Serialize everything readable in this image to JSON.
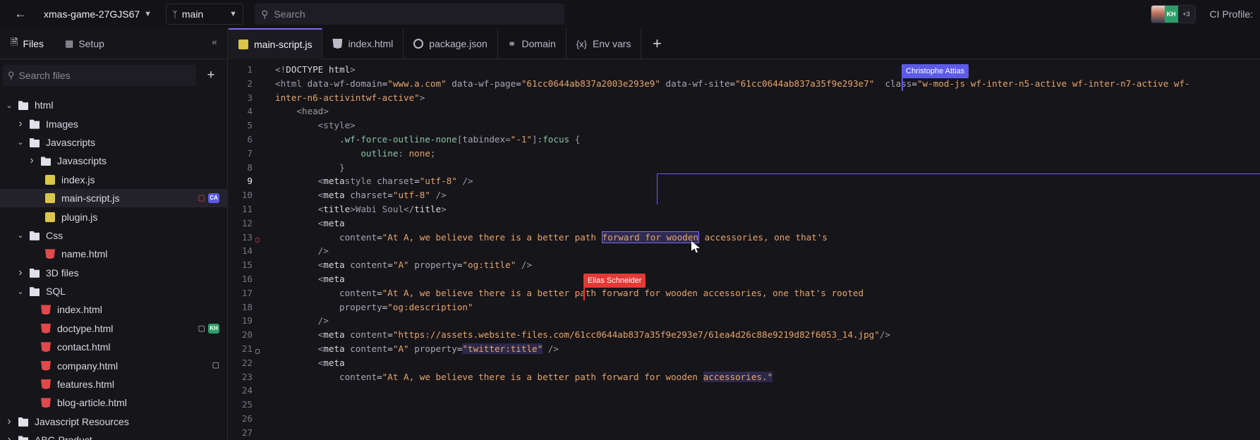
{
  "header": {
    "project": "xmas-game-27GJS67",
    "branch": "main",
    "search_placeholder": "Search",
    "collaborators_more": "+3",
    "collaborator_initials": "KH",
    "right_label": "CI Profile:"
  },
  "sidebar": {
    "tabs": [
      "Files",
      "Setup"
    ],
    "search_placeholder": "Search files",
    "tree": [
      {
        "label": "html",
        "type": "folder",
        "level": 0,
        "expanded": true
      },
      {
        "label": "Images",
        "type": "folder",
        "level": 1,
        "expanded": false
      },
      {
        "label": "Javascripts",
        "type": "folder",
        "level": 1,
        "expanded": true
      },
      {
        "label": "Javascripts",
        "type": "folder",
        "level": 2,
        "expanded": false
      },
      {
        "label": "index.js",
        "type": "js",
        "level": 2
      },
      {
        "label": "main-script.js",
        "type": "js",
        "level": 2,
        "selected": true,
        "comment": true,
        "avatar": "CA"
      },
      {
        "label": "plugin.js",
        "type": "js",
        "level": 2
      },
      {
        "label": "Css",
        "type": "folder",
        "level": 1,
        "expanded": true
      },
      {
        "label": "name.html",
        "type": "html",
        "level": 2
      },
      {
        "label": "3D files",
        "type": "folder",
        "level": 1,
        "expanded": false
      },
      {
        "label": "SQL",
        "type": "folder",
        "level": 1,
        "expanded": true
      },
      {
        "label": "index.html",
        "type": "html",
        "level": 1
      },
      {
        "label": "doctype.html",
        "type": "html",
        "level": 1,
        "comment": true,
        "avatar": "KH"
      },
      {
        "label": "contact.html",
        "type": "html",
        "level": 1
      },
      {
        "label": "company.html",
        "type": "html",
        "level": 1,
        "comment": true
      },
      {
        "label": "features.html",
        "type": "html",
        "level": 1
      },
      {
        "label": "blog-article.html",
        "type": "html",
        "level": 1
      },
      {
        "label": "Javascript Resources",
        "type": "folder",
        "level": 0,
        "expanded": false
      },
      {
        "label": "ABC-Product",
        "type": "folder",
        "level": 0,
        "expanded": false
      }
    ]
  },
  "editor_tabs": [
    {
      "label": "main-script.js",
      "icon": "js",
      "active": true
    },
    {
      "label": "index.html",
      "icon": "html"
    },
    {
      "label": "package.json",
      "icon": "json"
    },
    {
      "label": "Domain",
      "icon": "link"
    },
    {
      "label": "Env vars",
      "icon": "brace"
    }
  ],
  "editor": {
    "current_line": 9,
    "lines": [
      {
        "n": 1,
        "tokens": [
          [
            "t",
            "<!"
          ],
          [
            "w",
            "DOCTYPE html"
          ],
          [
            "t",
            ">"
          ]
        ]
      },
      {
        "n": 2,
        "tokens": [
          [
            "t",
            "<html "
          ],
          [
            "a",
            "data-wf-domain"
          ],
          [
            "w",
            "="
          ],
          [
            "s",
            "\"www.a.com\""
          ],
          [
            "a",
            " data-wf-page"
          ],
          [
            "w",
            "="
          ],
          [
            "s",
            "\"61cc0644ab837a2003e293e9\""
          ],
          [
            "a",
            " data-wf-site"
          ],
          [
            "w",
            "="
          ],
          [
            "s",
            "\"61cc0644ab837a35f9e293e7\""
          ],
          [
            "a",
            "  class"
          ],
          [
            "w",
            "="
          ],
          [
            "s",
            "\"w-mod-js wf-inter-n5-active wf-inter-n7-active wf-"
          ]
        ]
      },
      {
        "n": 3,
        "tokens": [
          [
            "s",
            "inter-n6-activintwf-active\""
          ],
          [
            "t",
            ">"
          ]
        ]
      },
      {
        "n": 4,
        "tokens": [
          [
            "w",
            "    "
          ],
          [
            "t",
            "<head>"
          ]
        ]
      },
      {
        "n": 5,
        "tokens": [
          [
            "w",
            "        "
          ],
          [
            "t",
            "<style>"
          ]
        ]
      },
      {
        "n": 6,
        "tokens": [
          [
            "w",
            "            "
          ],
          [
            "c",
            ".wf-force-outline-none"
          ],
          [
            "t",
            "["
          ],
          [
            "a",
            "tabindex"
          ],
          [
            "t",
            "="
          ],
          [
            "s",
            "\"-1\""
          ],
          [
            "t",
            "]"
          ],
          [
            "c",
            ":focus "
          ],
          [
            "t",
            "{"
          ]
        ]
      },
      {
        "n": 7,
        "tokens": [
          [
            "w",
            "                "
          ],
          [
            "c",
            "outline"
          ],
          [
            "t",
            ": "
          ],
          [
            "s",
            "none"
          ],
          [
            "t",
            ";"
          ]
        ]
      },
      {
        "n": 8,
        "tokens": [
          [
            "w",
            "            "
          ],
          [
            "t",
            "}"
          ]
        ]
      },
      {
        "n": 9,
        "tokens": [
          [
            "w",
            "        "
          ],
          [
            "t",
            "<"
          ],
          [
            "w",
            "meta"
          ],
          [
            "t",
            "style "
          ],
          [
            "a",
            "charset"
          ],
          [
            "w",
            "="
          ],
          [
            "s",
            "\"utf-8\""
          ],
          [
            "t",
            " />"
          ]
        ]
      },
      {
        "n": 10,
        "tokens": [
          [
            "w",
            "        "
          ],
          [
            "t",
            "<"
          ],
          [
            "w",
            "meta "
          ],
          [
            "a",
            "charset"
          ],
          [
            "w",
            "="
          ],
          [
            "s",
            "\"utf-8\""
          ],
          [
            "t",
            " />"
          ]
        ]
      },
      {
        "n": 11,
        "tokens": [
          [
            "w",
            "        "
          ],
          [
            "t",
            "<"
          ],
          [
            "w",
            "title"
          ],
          [
            "t",
            ">Wabi Soul</"
          ],
          [
            "w",
            "title"
          ],
          [
            "t",
            ">"
          ]
        ]
      },
      {
        "n": 12,
        "tokens": [
          [
            "w",
            "        "
          ],
          [
            "t",
            "<"
          ],
          [
            "w",
            "meta"
          ]
        ]
      },
      {
        "n": 13,
        "tokens": [
          [
            "w",
            "            "
          ],
          [
            "a",
            "content"
          ],
          [
            "w",
            "="
          ],
          [
            "s",
            "\"At A, we believe there is a better path "
          ],
          [
            "sel",
            "forward for wooden"
          ],
          [
            "s",
            " accessories, one that's"
          ]
        ],
        "gutter": "red"
      },
      {
        "n": 14,
        "tokens": [
          [
            "w",
            "        "
          ],
          [
            "t",
            "/>"
          ]
        ]
      },
      {
        "n": 15,
        "tokens": [
          [
            "w",
            "        "
          ],
          [
            "t",
            "<"
          ],
          [
            "w",
            "meta "
          ],
          [
            "a",
            "content"
          ],
          [
            "w",
            "="
          ],
          [
            "s",
            "\"A\""
          ],
          [
            "a",
            " property"
          ],
          [
            "w",
            "="
          ],
          [
            "s",
            "\"og:title\""
          ],
          [
            "t",
            " />"
          ]
        ]
      },
      {
        "n": 16,
        "tokens": [
          [
            "w",
            "        "
          ],
          [
            "t",
            "<"
          ],
          [
            "w",
            "meta"
          ]
        ]
      },
      {
        "n": 17,
        "tokens": [
          [
            "w",
            "            "
          ],
          [
            "a",
            "content"
          ],
          [
            "w",
            "="
          ],
          [
            "s",
            "\"At A, we believe there is a better path forward for wooden accessories, one that's rooted"
          ]
        ]
      },
      {
        "n": 18,
        "tokens": [
          [
            "w",
            "            "
          ],
          [
            "a",
            "property"
          ],
          [
            "w",
            "="
          ],
          [
            "s",
            "\"og:description\""
          ]
        ]
      },
      {
        "n": 19,
        "tokens": [
          [
            "w",
            "        "
          ],
          [
            "t",
            "/>"
          ]
        ]
      },
      {
        "n": 20,
        "tokens": [
          [
            "w",
            "        "
          ],
          [
            "t",
            "<"
          ],
          [
            "w",
            "meta "
          ],
          [
            "a",
            "content"
          ],
          [
            "w",
            "="
          ],
          [
            "s",
            "\"https://assets.website-files.com/61cc0644ab837a35f9e293e7/61ea4d26c88e9219d82f6053_14.jpg\""
          ],
          [
            "t",
            "/>"
          ]
        ]
      },
      {
        "n": 21,
        "tokens": [
          [
            "w",
            "        "
          ],
          [
            "t",
            "<"
          ],
          [
            "w",
            "meta "
          ],
          [
            "a",
            "content"
          ],
          [
            "w",
            "="
          ],
          [
            "s",
            "\"A\""
          ],
          [
            "a",
            " property"
          ],
          [
            "w",
            "="
          ],
          [
            "soft",
            "\"twitter:title\""
          ],
          [
            "t",
            " />"
          ]
        ],
        "gutter": "normal"
      },
      {
        "n": 22,
        "tokens": [
          [
            "w",
            "        "
          ],
          [
            "t",
            "<"
          ],
          [
            "w",
            "meta"
          ]
        ]
      },
      {
        "n": 23,
        "tokens": [
          [
            "w",
            "            "
          ],
          [
            "a",
            "content"
          ],
          [
            "w",
            "="
          ],
          [
            "s",
            "\"At A, we believe there is a better path forward for wooden "
          ],
          [
            "soft",
            "accessories.\""
          ]
        ]
      },
      {
        "n": 24,
        "tokens": []
      },
      {
        "n": 25,
        "tokens": []
      },
      {
        "n": 26,
        "tokens": []
      },
      {
        "n": 27,
        "tokens": []
      }
    ]
  },
  "collaborator_cursors": [
    {
      "name": "Christophe Attias",
      "color": "#5b5be8"
    },
    {
      "name": "Elias Schneider",
      "color": "#e53935"
    }
  ]
}
